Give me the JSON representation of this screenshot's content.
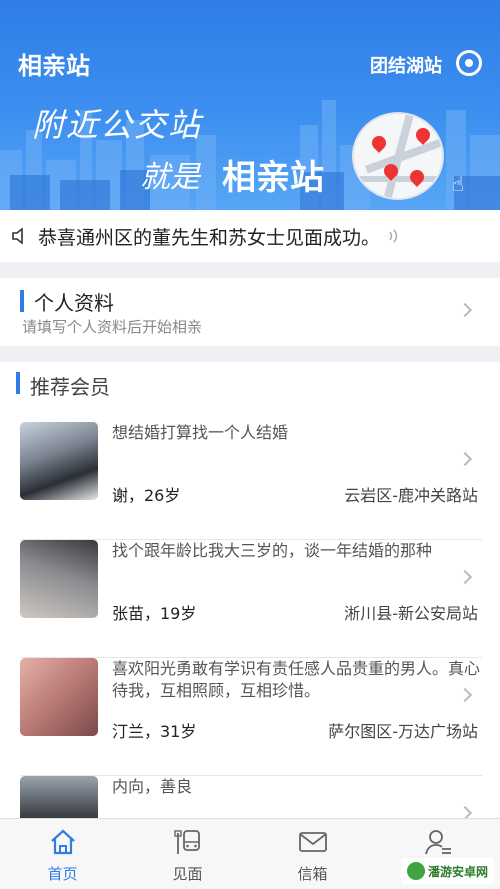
{
  "header": {
    "app_title": "相亲站",
    "station_name": "团结湖站",
    "slogan_line1": "附近公交站",
    "slogan_line2_a": "就是",
    "slogan_line2_b": "相亲站"
  },
  "notice": {
    "text": "恭喜通州区的董先生和苏女士见面成功。"
  },
  "profile": {
    "title": "个人资料",
    "subtitle": "请填写个人资料后开始相亲"
  },
  "recommend": {
    "title": "推荐会员",
    "members": [
      {
        "bio": "想结婚打算找一个人结婚",
        "name": "谢，26岁",
        "location": "云岩区-鹿冲关路站"
      },
      {
        "bio": "找个跟年龄比我大三岁的，谈一年结婚的那种",
        "name": "张苗，19岁",
        "location": "淅川县-新公安局站"
      },
      {
        "bio": "喜欢阳光勇敢有学识有责任感人品贵重的男人。真心待我，互相照顾，互相珍惜。",
        "name": "汀兰，31岁",
        "location": "萨尔图区-万达广场站"
      },
      {
        "bio": "内向，善良",
        "name": "",
        "location": ""
      }
    ]
  },
  "tabbar": {
    "tabs": [
      {
        "label": "首页",
        "icon": "home-icon"
      },
      {
        "label": "见面",
        "icon": "bus-stop-icon"
      },
      {
        "label": "信箱",
        "icon": "mail-icon"
      },
      {
        "label": "",
        "icon": "user-list-icon"
      }
    ]
  },
  "watermark": "潘游安卓网",
  "colors": {
    "accent": "#2e7de6",
    "header_blue": "#3d8ff0"
  }
}
